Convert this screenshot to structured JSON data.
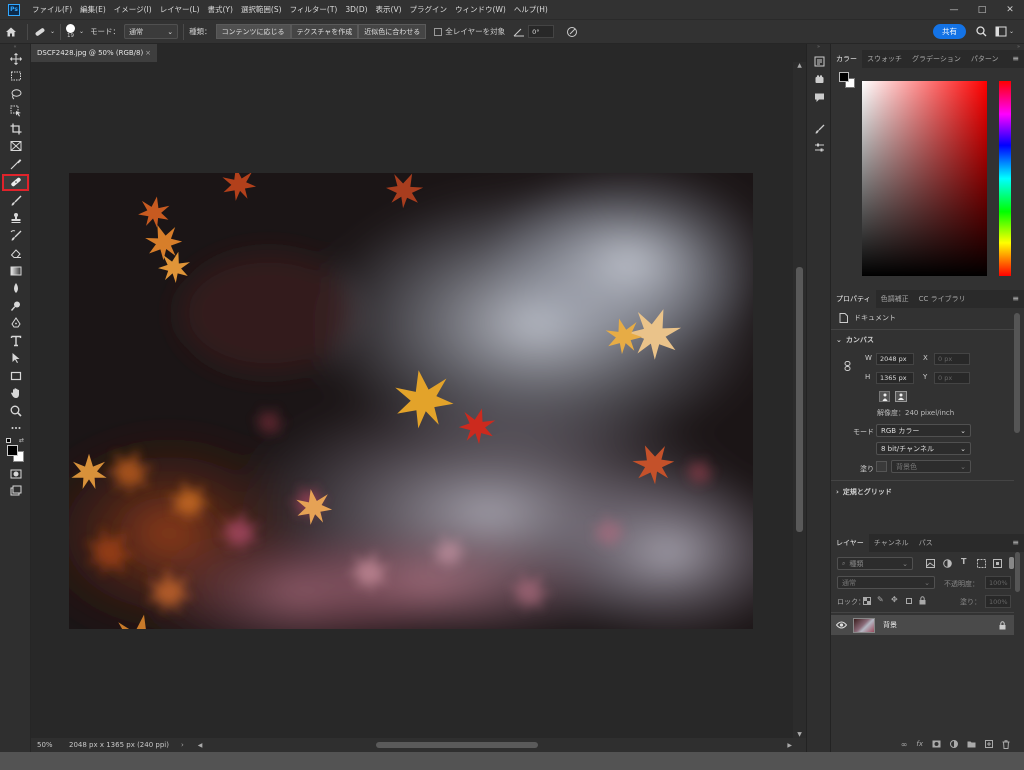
{
  "menubar": {
    "logo": "Ps",
    "items": [
      "ファイル(F)",
      "編集(E)",
      "イメージ(I)",
      "レイヤー(L)",
      "書式(Y)",
      "選択範囲(S)",
      "フィルター(T)",
      "3D(D)",
      "表示(V)",
      "プラグイン",
      "ウィンドウ(W)",
      "ヘルプ(H)"
    ],
    "window_controls": [
      "—",
      "□",
      "✕"
    ]
  },
  "options": {
    "brush_size": "19",
    "mode_label": "モード：",
    "mode_value": "通常",
    "type_label": "種類：",
    "type_buttons": [
      "コンテンツに応じる",
      "テクスチャを作成",
      "近似色に合わせる"
    ],
    "all_layers_label": "全レイヤーを対象",
    "angle_value": "0°",
    "share_label": "共有"
  },
  "document": {
    "tab_title": "DSCF2428.jpg @ 50% (RGB/8)",
    "zoom": "50%",
    "size_info": "2048 px x 1365 px (240 ppi)"
  },
  "color_panel": {
    "tabs": [
      "カラー",
      "スウォッチ",
      "グラデーション",
      "パターン"
    ],
    "foreground": "#000000",
    "background": "#ffffff",
    "hue_color": "#ff0000"
  },
  "properties_panel": {
    "tabs": [
      "プロパティ",
      "色調補正",
      "CC ライブラリ"
    ],
    "doc_label": "ドキュメント",
    "canvas_title": "カンバス",
    "w_label": "W",
    "w_value": "2048 px",
    "h_label": "H",
    "h_value": "1365 px",
    "x_label": "X",
    "x_placeholder": "0 px",
    "y_label": "Y",
    "y_placeholder": "0 px",
    "resolution": "解像度：240 pixel/inch",
    "mode_label": "モード",
    "mode_value": "RGB カラー",
    "depth_value": "8 bit/チャンネル",
    "fill_label": "塗り",
    "fill_value": "背景色",
    "rulers_title": "定規とグリッド"
  },
  "layers_panel": {
    "tabs": [
      "レイヤー",
      "チャンネル",
      "パス"
    ],
    "search_placeholder": "種類",
    "blend_mode": "通常",
    "opacity_label": "不透明度：",
    "opacity_value": "100%",
    "lock_label": "ロック：",
    "fill_label": "塗り：",
    "fill_value": "100%",
    "layer_name": "背景"
  }
}
